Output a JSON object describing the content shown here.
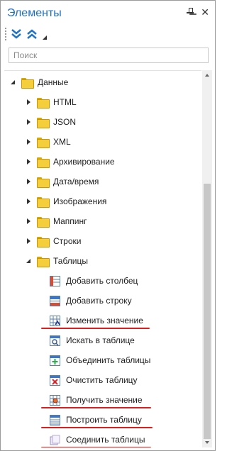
{
  "panel": {
    "title": "Элементы"
  },
  "search": {
    "placeholder": "Поиск"
  },
  "tree": {
    "root": "Данные",
    "folders": [
      "HTML",
      "JSON",
      "XML",
      "Архивирование",
      "Дата/время",
      "Изображения",
      "Маппинг",
      "Строки",
      "Таблицы"
    ],
    "table_items": [
      "Добавить столбец",
      "Добавить строку",
      "Изменить значение",
      "Искать в таблице",
      "Объединить таблицы",
      "Очистить таблицу",
      "Получить значение",
      "Построить таблицу",
      "Соединить таблицы"
    ]
  },
  "highlights": [
    "Изменить значение",
    "Получить значение",
    "Построить таблицу",
    "Соединить таблицы"
  ],
  "colors": {
    "title": "#1e6fc4",
    "highlight": "#e21b1b",
    "folder": "#f5cf3b"
  }
}
